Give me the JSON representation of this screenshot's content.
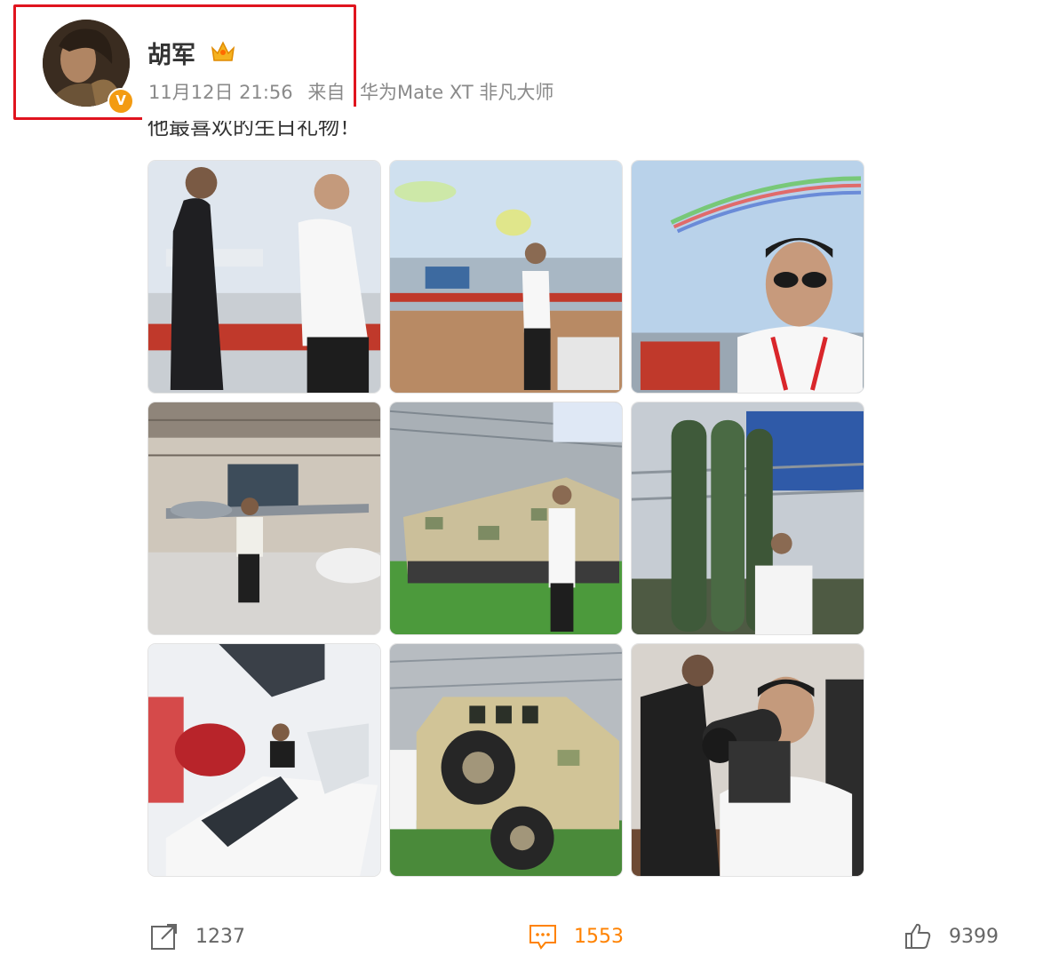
{
  "post": {
    "author": "胡军",
    "timestamp": "11月12日 21:56",
    "source_prefix": "来自",
    "source_device": "华为Mate XT 非凡大师",
    "text": "他最喜欢的生日礼物！",
    "verified_badge": "V"
  },
  "photos": [
    {
      "icon": "photo-airshow-two-men"
    },
    {
      "icon": "photo-airshow-tarmac"
    },
    {
      "icon": "photo-selfie-contrails"
    },
    {
      "icon": "photo-drone-hall"
    },
    {
      "icon": "photo-camo-tank"
    },
    {
      "icon": "photo-missile-launcher"
    },
    {
      "icon": "photo-cockpit-simulator"
    },
    {
      "icon": "photo-armored-vehicle"
    },
    {
      "icon": "photo-weapon-scope"
    }
  ],
  "actions": {
    "repost_count": "1237",
    "comment_count": "1553",
    "like_count": "9399"
  },
  "colors": {
    "highlight": "#e0141e",
    "accent_orange": "#ff8200",
    "badge": "#f39b12"
  }
}
